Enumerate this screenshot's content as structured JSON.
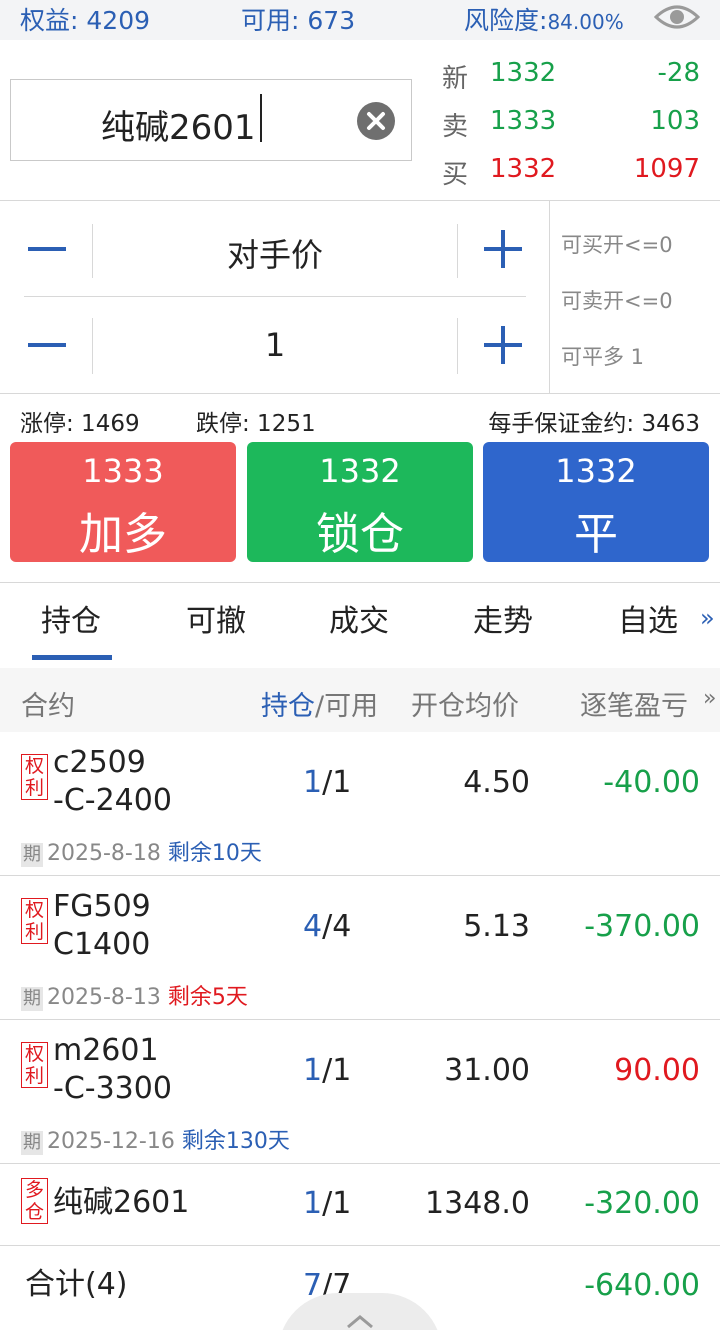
{
  "account": {
    "equity_label": "权益:",
    "equity_value": "4209",
    "available_label": "可用:",
    "available_value": "673",
    "risk_label": "风险度:",
    "risk_value": "84.00%"
  },
  "symbol": {
    "value": "纯碱2601"
  },
  "quote": {
    "last_label": "新",
    "last_price": "1332",
    "last_change": "-28",
    "ask_label": "卖",
    "ask_price": "1333",
    "ask_volume": "103",
    "bid_label": "买",
    "bid_price": "1332",
    "bid_volume": "1097"
  },
  "order": {
    "price_type": "对手价",
    "quantity": "1"
  },
  "availability": {
    "can_buy_open": "可买开<=0",
    "can_sell_open": "可卖开<=0",
    "can_close_long": "可平多 1"
  },
  "limits": {
    "limit_up": "涨停: 1469",
    "limit_down": "跌停: 1251",
    "margin": "每手保证金约: 3463"
  },
  "actions": [
    {
      "price": "1333",
      "label": "加多",
      "color": "#f05a5a"
    },
    {
      "price": "1332",
      "label": "锁仓",
      "color": "#1db85b"
    },
    {
      "price": "1332",
      "label": "平",
      "color": "#2f66cc"
    }
  ],
  "tabs": [
    "持仓",
    "可撤",
    "成交",
    "走势",
    "自选"
  ],
  "tabs_more": "»",
  "table": {
    "headers": {
      "contract": "合约",
      "position": "持仓",
      "available": "/可用",
      "avg_price": "开仓均价",
      "pnl": "逐笔盈亏",
      "more": "»"
    },
    "rows": [
      {
        "badge_top": "权",
        "badge_bottom": "利",
        "name_line1": "c2509",
        "name_line2": "-C-2400",
        "pos": "1",
        "avail": "/1",
        "avg": "4.50",
        "pnl": "-40.00",
        "pnl_color": "green",
        "exp_tag": "期",
        "exp_date": "2025-8-18",
        "exp_remain": "剩余10天",
        "remain_color": "blue"
      },
      {
        "badge_top": "权",
        "badge_bottom": "利",
        "name_line1": "FG509",
        "name_line2": "C1400",
        "pos": "4",
        "avail": "/4",
        "avg": "5.13",
        "pnl": "-370.00",
        "pnl_color": "green",
        "exp_tag": "期",
        "exp_date": "2025-8-13",
        "exp_remain": "剩余5天",
        "remain_color": "red"
      },
      {
        "badge_top": "权",
        "badge_bottom": "利",
        "name_line1": "m2601",
        "name_line2": "-C-3300",
        "pos": "1",
        "avail": "/1",
        "avg": "31.00",
        "pnl": "90.00",
        "pnl_color": "red",
        "exp_tag": "期",
        "exp_date": "2025-12-16",
        "exp_remain": "剩余130天",
        "remain_color": "blue"
      },
      {
        "badge_top": "多",
        "badge_bottom": "仓",
        "name_line1": "纯碱2601",
        "pos": "1",
        "avail": "/1",
        "avg": "1348.0",
        "pnl": "-320.00",
        "pnl_color": "green"
      }
    ],
    "total": {
      "label": "合计(4)",
      "pos": "7",
      "avail": "/7",
      "pnl": "-640.00"
    }
  }
}
